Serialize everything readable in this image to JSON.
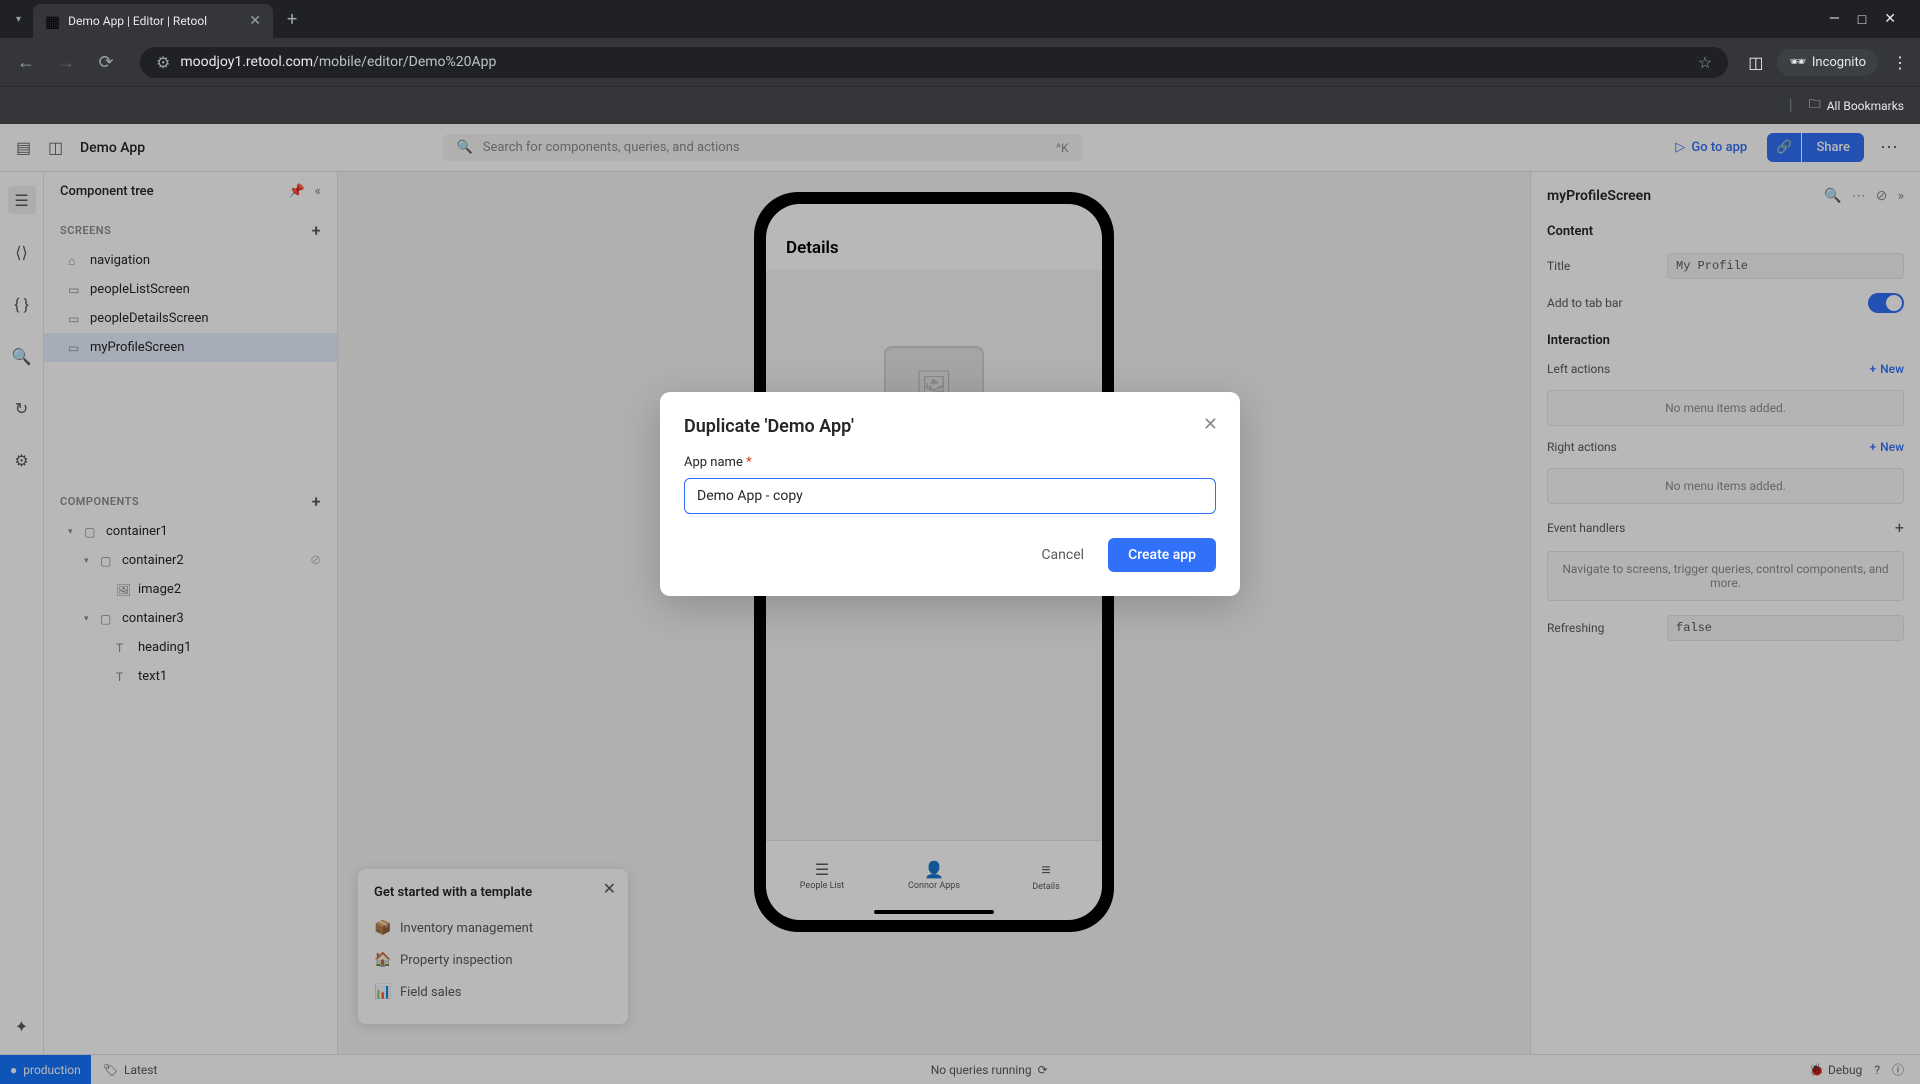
{
  "browser": {
    "tab_title": "Demo App | Editor | Retool",
    "url_prefix": "moodjoy1.retool.com",
    "url_path": "/mobile/editor/Demo%20App",
    "incognito_label": "Incognito",
    "all_bookmarks": "All Bookmarks"
  },
  "header": {
    "app_title": "Demo App",
    "search_placeholder": "Search for components, queries, and actions",
    "search_shortcut": "^K",
    "goto_app": "Go to app",
    "share": "Share"
  },
  "left_panel": {
    "title": "Component tree",
    "screens_label": "SCREENS",
    "components_label": "COMPONENTS",
    "screens": [
      {
        "name": "navigation",
        "icon": "home"
      },
      {
        "name": "peopleListScreen",
        "icon": "screen"
      },
      {
        "name": "peopleDetailsScreen",
        "icon": "screen"
      },
      {
        "name": "myProfileScreen",
        "icon": "screen",
        "selected": true
      }
    ],
    "components": [
      {
        "name": "container1",
        "indent": 0,
        "icon": "box",
        "caret": true
      },
      {
        "name": "container2",
        "indent": 1,
        "icon": "box",
        "caret": true,
        "hidden": true
      },
      {
        "name": "image2",
        "indent": 2,
        "icon": "image"
      },
      {
        "name": "container3",
        "indent": 1,
        "icon": "box",
        "caret": true
      },
      {
        "name": "heading1",
        "indent": 2,
        "icon": "text"
      },
      {
        "name": "text1",
        "indent": 2,
        "icon": "text"
      }
    ]
  },
  "templates": {
    "title": "Get started with a template",
    "items": [
      "Inventory management",
      "Property inspection",
      "Field sales"
    ]
  },
  "phone": {
    "title": "Details",
    "tabs": [
      "People List",
      "Connor Apps",
      "Details"
    ]
  },
  "inspector": {
    "title": "myProfileScreen",
    "content_label": "Content",
    "title_label": "Title",
    "title_value": "My Profile",
    "tabbar_label": "Add to tab bar",
    "interaction_label": "Interaction",
    "left_actions": "Left actions",
    "right_actions": "Right actions",
    "new_label": "New",
    "no_items": "No menu items added.",
    "event_handlers": "Event handlers",
    "event_placeholder": "Navigate to screens, trigger queries, control components, and more.",
    "refreshing_label": "Refreshing",
    "refreshing_value": "false"
  },
  "footer": {
    "env": "production",
    "latest": "Latest",
    "status": "No queries running",
    "debug": "Debug"
  },
  "modal": {
    "title": "Duplicate 'Demo App'",
    "label": "App name",
    "value": "Demo App - copy",
    "cancel": "Cancel",
    "create": "Create app"
  }
}
